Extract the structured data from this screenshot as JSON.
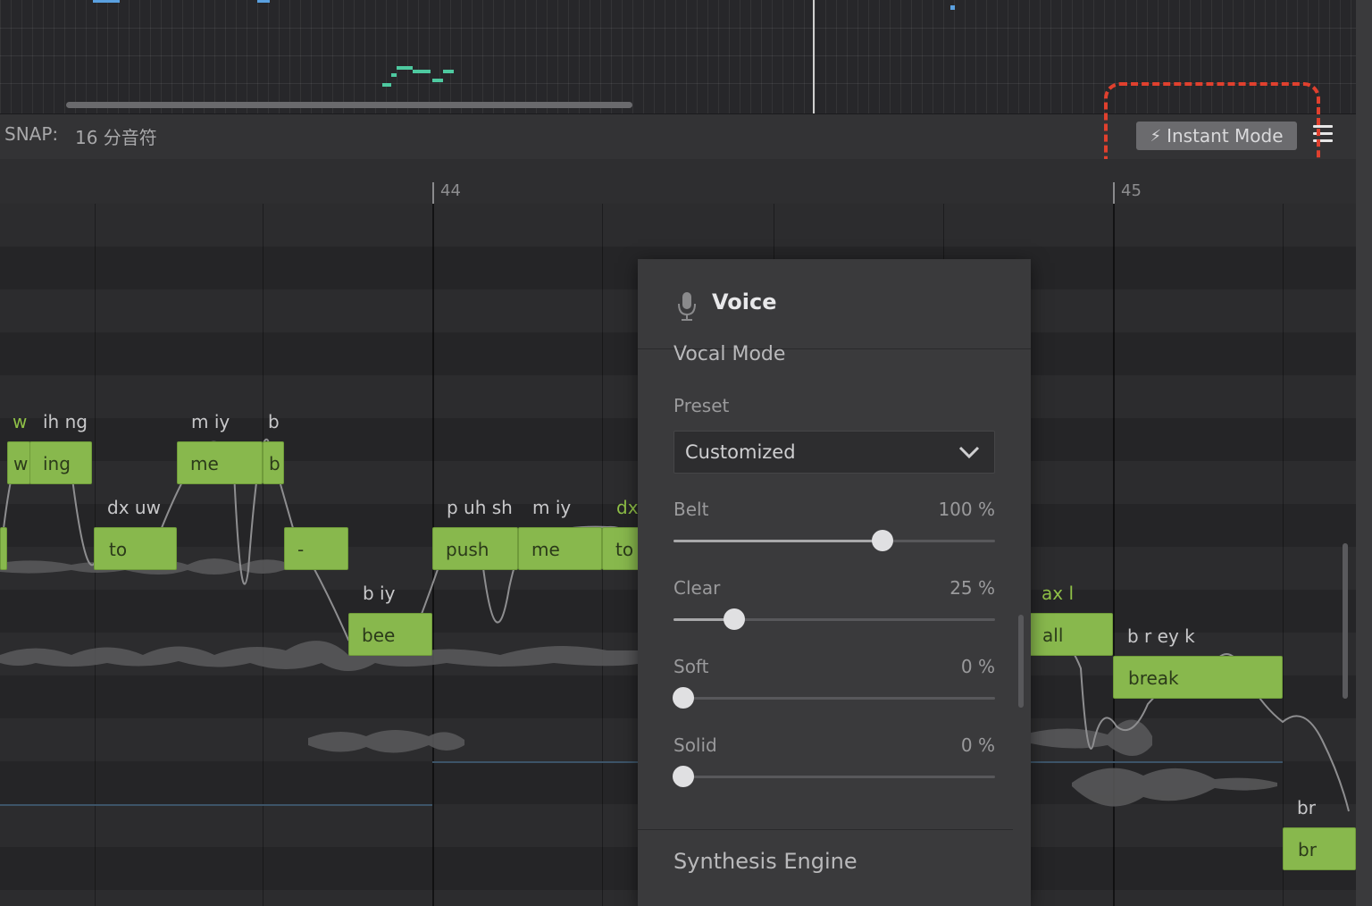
{
  "toolbar": {
    "snap_label": "SNAP:",
    "snap_value": "16 分音符",
    "instant_mode_label": "Instant Mode"
  },
  "ruler": {
    "bars": [
      "44",
      "45"
    ]
  },
  "notes": [
    {
      "lyric": "w",
      "phonemes": "w",
      "phoneme_highlight": true
    },
    {
      "lyric": "ing",
      "phonemes": "ih ng"
    },
    {
      "lyric": "to",
      "phonemes": "dx uw"
    },
    {
      "lyric": "me",
      "phonemes": "m iy"
    },
    {
      "lyric": "b",
      "phonemes": "b"
    },
    {
      "lyric": "-",
      "phonemes": ""
    },
    {
      "lyric": "bee",
      "phonemes": "b iy"
    },
    {
      "lyric": "push",
      "phonemes": "p uh sh"
    },
    {
      "lyric": "me",
      "phonemes": "m iy"
    },
    {
      "lyric": "to",
      "phonemes": "dx",
      "phoneme_highlight": true
    },
    {
      "lyric": "all",
      "phonemes": "ax l",
      "phoneme_highlight": true
    },
    {
      "lyric": "break",
      "phonemes": "b r ey k"
    },
    {
      "lyric": "br",
      "phonemes": "br"
    }
  ],
  "voice_panel": {
    "title": "Voice",
    "section_vocal_mode": "Vocal Mode",
    "preset_label": "Preset",
    "preset_value": "Customized",
    "sliders": [
      {
        "label": "Belt",
        "value_text": "100 %",
        "fraction": 0.65
      },
      {
        "label": "Clear",
        "value_text": "25 %",
        "fraction": 0.19
      },
      {
        "label": "Soft",
        "value_text": "0 %",
        "fraction": 0.03
      },
      {
        "label": "Solid",
        "value_text": "0 %",
        "fraction": 0.03
      }
    ],
    "section_engine": "Synthesis Engine"
  },
  "colors": {
    "note_fill": "#88b84d",
    "highlight_dash": "#e0402e",
    "phoneme_green": "#8fc047"
  }
}
